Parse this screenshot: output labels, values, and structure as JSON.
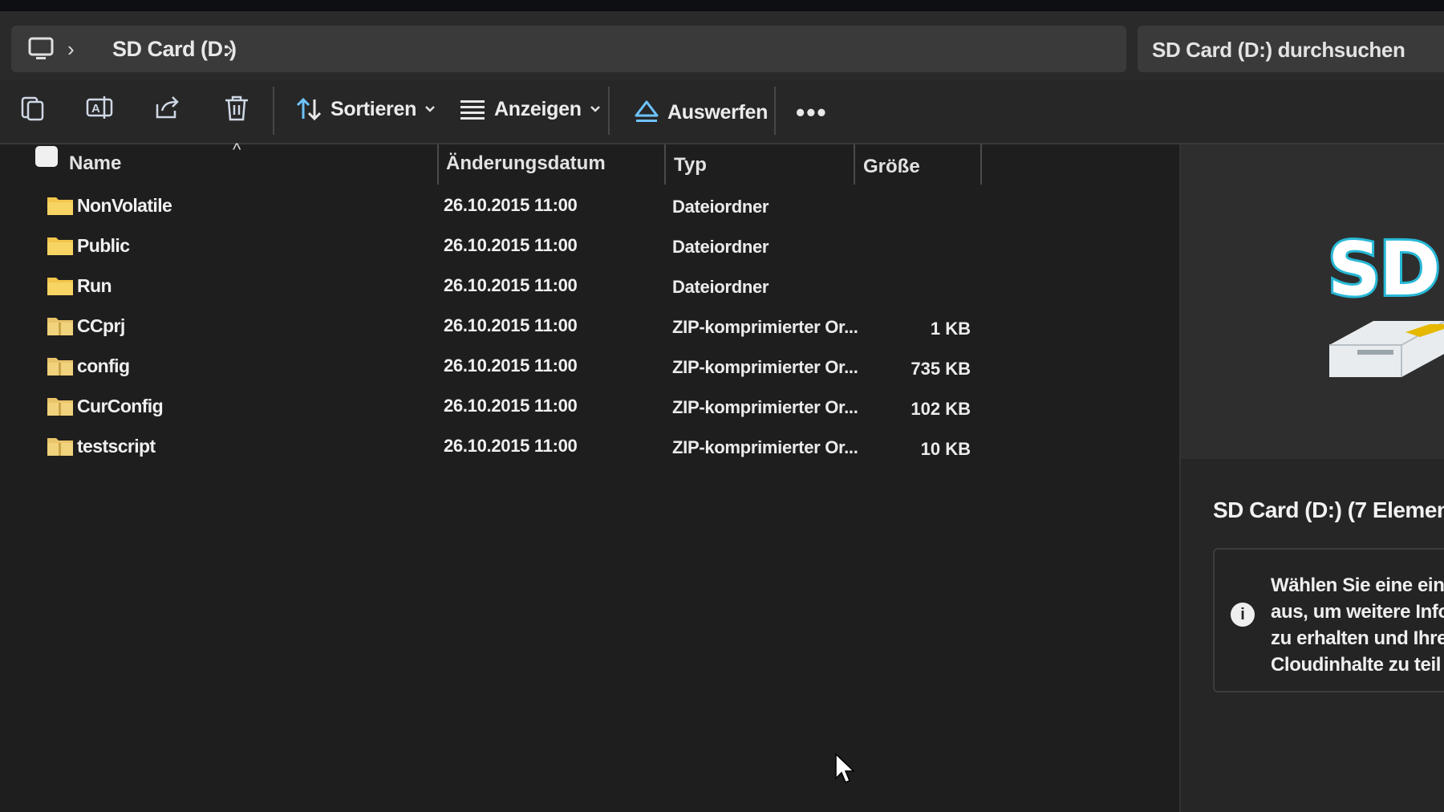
{
  "address": {
    "separator": "›",
    "crumb": "SD Card (D:)",
    "search_placeholder": "SD Card (D:) durchsuchen"
  },
  "toolbar": {
    "icons": [
      "copy-icon",
      "rename-icon",
      "share-icon",
      "delete-icon"
    ],
    "sort_label": "Sortieren",
    "view_label": "Anzeigen",
    "eject_label": "Auswerfen",
    "more_label": "•••"
  },
  "columns": {
    "name": "Name",
    "date": "Änderungsdatum",
    "type": "Typ",
    "size": "Größe"
  },
  "files": [
    {
      "name": "NonVolatile",
      "date": "26.10.2015 11:00",
      "type": "Dateiordner",
      "size": ""
    },
    {
      "name": "Public",
      "date": "26.10.2015 11:00",
      "type": "Dateiordner",
      "size": ""
    },
    {
      "name": "Run",
      "date": "26.10.2015 11:00",
      "type": "Dateiordner",
      "size": ""
    },
    {
      "name": "CCprj",
      "date": "26.10.2015 11:00",
      "type": "ZIP-komprimierter Or...",
      "size": "1 KB"
    },
    {
      "name": "config",
      "date": "26.10.2015 11:00",
      "type": "ZIP-komprimierter Or...",
      "size": "735 KB"
    },
    {
      "name": "CurConfig",
      "date": "26.10.2015 11:00",
      "type": "ZIP-komprimierter Or...",
      "size": "102 KB"
    },
    {
      "name": "testscript",
      "date": "26.10.2015 11:00",
      "type": "ZIP-komprimierter Or...",
      "size": "10 KB"
    }
  ],
  "details": {
    "logo_text": "SD",
    "title": "SD Card (D:) (7 Elemen",
    "info_icon": "i",
    "info_lines": [
      "Wählen Sie eine ein",
      "aus, um weitere Info",
      "zu erhalten und Ihre",
      "Cloudinhalte zu teil"
    ]
  },
  "colors": {
    "folder": "#f2c64b",
    "zipfolder": "#e9c46a",
    "accent": "#27b8d6"
  }
}
